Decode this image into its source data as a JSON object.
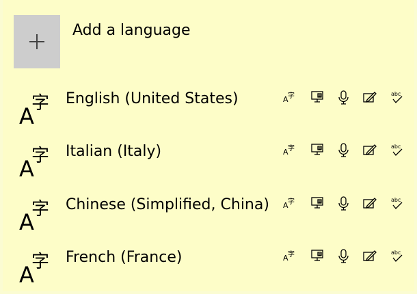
{
  "add_language": {
    "label": "Add a language",
    "icon": "plus-icon"
  },
  "languages": [
    {
      "name": "English (United States)",
      "icon": "language-character-icon"
    },
    {
      "name": "Italian (Italy)",
      "icon": "language-character-icon"
    },
    {
      "name": "Chinese (Simplified, China)",
      "icon": "language-character-icon"
    },
    {
      "name": "French (France)",
      "icon": "language-character-icon"
    }
  ],
  "feature_icons": [
    "text-to-speech-icon",
    "display-language-icon",
    "speech-recognition-icon",
    "handwriting-icon",
    "spell-check-icon"
  ],
  "colors": {
    "background": "#fdfdc8",
    "add_tile": "#cdcdcd",
    "text": "#000000"
  }
}
